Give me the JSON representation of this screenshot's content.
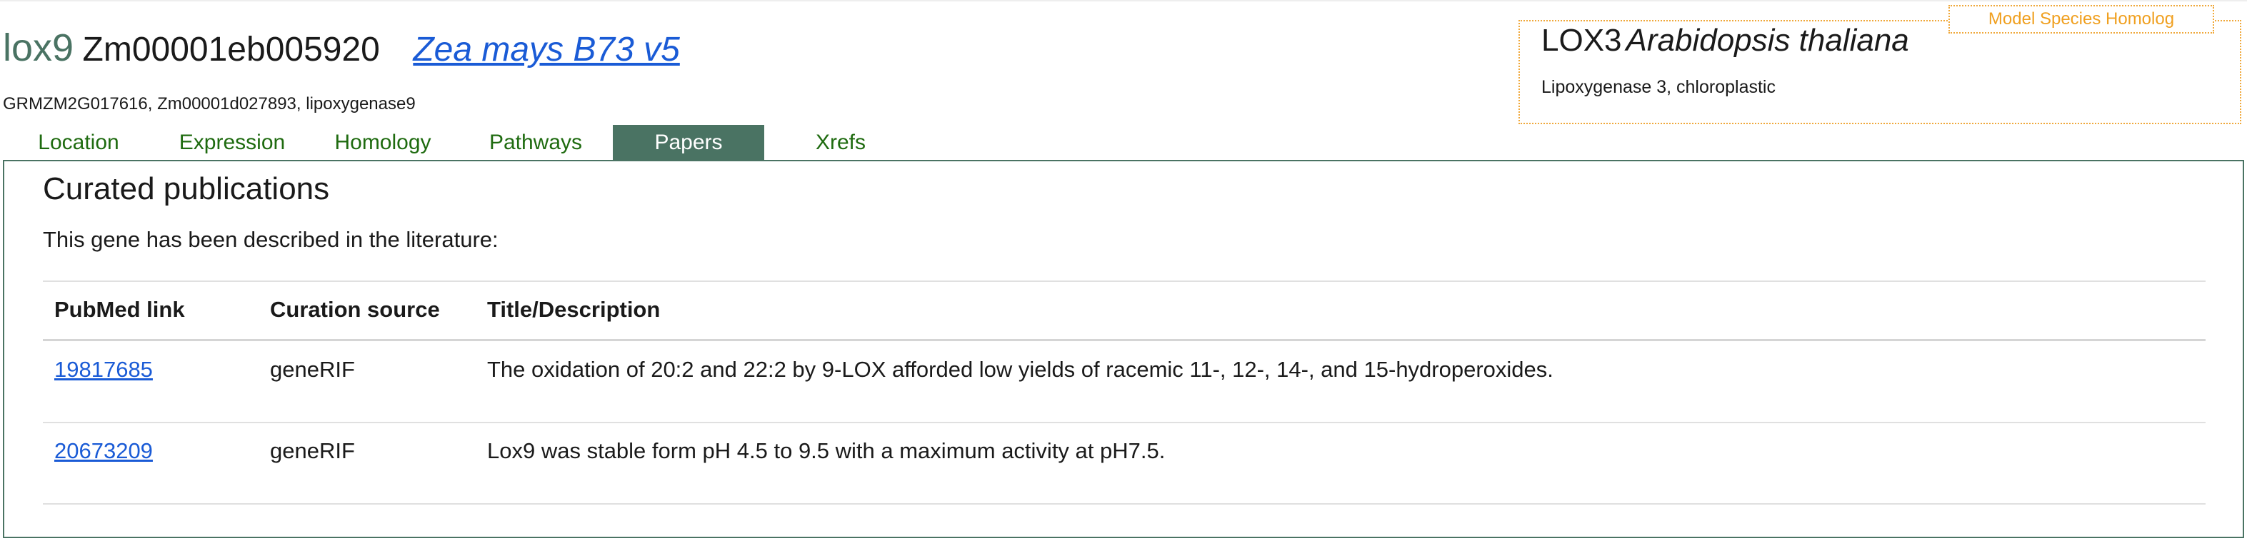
{
  "gene": {
    "symbol": "lox9",
    "id": "Zm00001eb005920",
    "genome_link": "Zea mays B73 v5",
    "synonyms": "GRMZM2G017616, Zm00001d027893, lipoxygenase9"
  },
  "homolog": {
    "tag": "Model Species Homolog",
    "symbol": "LOX3",
    "species": "Arabidopsis thaliana",
    "description": "Lipoxygenase 3, chloroplastic"
  },
  "tabs": [
    {
      "label": "Location",
      "active": false
    },
    {
      "label": "Expression",
      "active": false
    },
    {
      "label": "Homology",
      "active": false
    },
    {
      "label": "Pathways",
      "active": false
    },
    {
      "label": "Papers",
      "active": true
    },
    {
      "label": "Xrefs",
      "active": false
    }
  ],
  "papers": {
    "title": "Curated publications",
    "intro": "This gene has been described in the literature:",
    "columns": [
      "PubMed link",
      "Curation source",
      "Title/Description"
    ],
    "rows": [
      {
        "pubmed": "19817685",
        "source": "geneRIF",
        "description": "The oxidation of 20:2 and 22:2 by 9-LOX afforded low yields of racemic 11-, 12-, 14-, and 15-hydroperoxides."
      },
      {
        "pubmed": "20673209",
        "source": "geneRIF",
        "description": "Lox9 was stable form pH 4.5 to 9.5 with a maximum activity at pH7.5."
      }
    ]
  },
  "colors": {
    "accent": "#4a7363",
    "tab_text": "#1f6b10",
    "link": "#1a5bd6",
    "homolog_border": "#f0a83a"
  }
}
